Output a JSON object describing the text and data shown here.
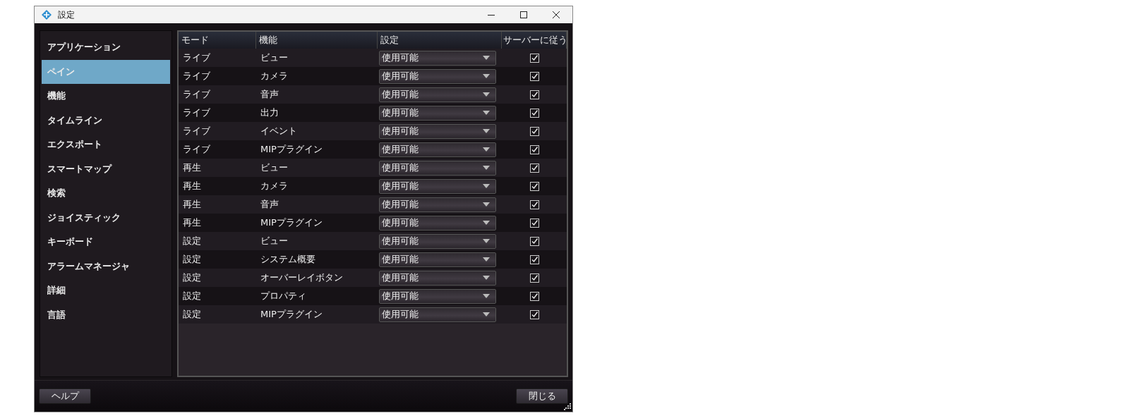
{
  "window": {
    "title": "設定"
  },
  "sidebar": {
    "items": [
      {
        "label": "アプリケーション",
        "selected": false
      },
      {
        "label": "ペイン",
        "selected": true
      },
      {
        "label": "機能",
        "selected": false
      },
      {
        "label": "タイムライン",
        "selected": false
      },
      {
        "label": "エクスポート",
        "selected": false
      },
      {
        "label": "スマートマップ",
        "selected": false
      },
      {
        "label": "検索",
        "selected": false
      },
      {
        "label": "ジョイスティック",
        "selected": false
      },
      {
        "label": "キーボード",
        "selected": false
      },
      {
        "label": "アラームマネージャ",
        "selected": false
      },
      {
        "label": "詳細",
        "selected": false
      },
      {
        "label": "言語",
        "selected": false
      }
    ]
  },
  "table": {
    "columns": [
      "モード",
      "機能",
      "設定",
      "サーバーに従う"
    ],
    "rows": [
      {
        "mode": "ライブ",
        "function": "ビュー",
        "setting": "使用可能",
        "follow_server": true
      },
      {
        "mode": "ライブ",
        "function": "カメラ",
        "setting": "使用可能",
        "follow_server": true
      },
      {
        "mode": "ライブ",
        "function": "音声",
        "setting": "使用可能",
        "follow_server": true
      },
      {
        "mode": "ライブ",
        "function": "出力",
        "setting": "使用可能",
        "follow_server": true
      },
      {
        "mode": "ライブ",
        "function": "イベント",
        "setting": "使用可能",
        "follow_server": true
      },
      {
        "mode": "ライブ",
        "function": "MIPプラグイン",
        "setting": "使用可能",
        "follow_server": true
      },
      {
        "mode": "再生",
        "function": "ビュー",
        "setting": "使用可能",
        "follow_server": true
      },
      {
        "mode": "再生",
        "function": "カメラ",
        "setting": "使用可能",
        "follow_server": true
      },
      {
        "mode": "再生",
        "function": "音声",
        "setting": "使用可能",
        "follow_server": true
      },
      {
        "mode": "再生",
        "function": "MIPプラグイン",
        "setting": "使用可能",
        "follow_server": true
      },
      {
        "mode": "設定",
        "function": "ビュー",
        "setting": "使用可能",
        "follow_server": true
      },
      {
        "mode": "設定",
        "function": "システム概要",
        "setting": "使用可能",
        "follow_server": true
      },
      {
        "mode": "設定",
        "function": "オーバーレイボタン",
        "setting": "使用可能",
        "follow_server": true
      },
      {
        "mode": "設定",
        "function": "プロパティ",
        "setting": "使用可能",
        "follow_server": true
      },
      {
        "mode": "設定",
        "function": "MIPプラグイン",
        "setting": "使用可能",
        "follow_server": true
      }
    ]
  },
  "footer": {
    "buttons": [
      "ヘルプ",
      "閉じる"
    ]
  }
}
